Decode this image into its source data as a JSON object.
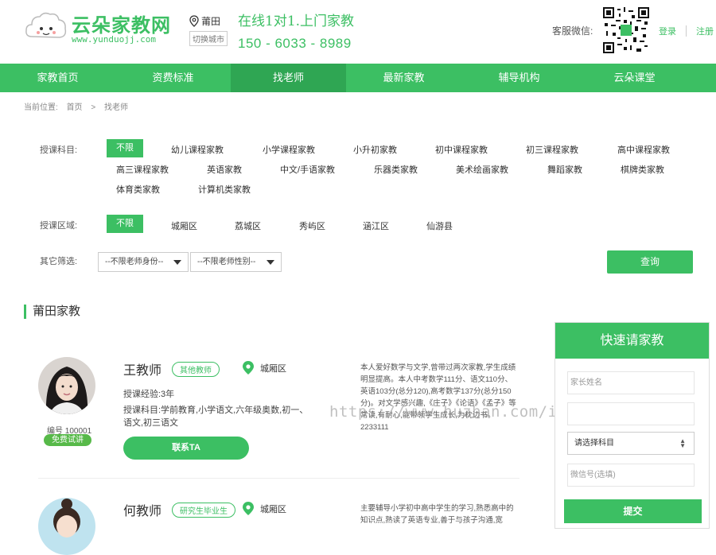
{
  "header": {
    "logo_name": "云朵家教网",
    "logo_url": "www.yunduojj.com",
    "city": "莆田",
    "city_switch": "切换城市",
    "slogan_1": "在线1对1.上门家教",
    "phone": "150 - 6033 - 8989",
    "wechat_label": "客服微信:",
    "login": "登录",
    "register": "注册"
  },
  "nav": [
    "家教首页",
    "资费标准",
    "找老师",
    "最新家教",
    "辅导机构",
    "云朵课堂"
  ],
  "breadcrumb": {
    "prefix": "当前位置:",
    "home": "首页",
    "sep": ">",
    "current": "找老师"
  },
  "filters": {
    "subject_label": "授课科目:",
    "subjects": [
      "不限",
      "幼儿课程家教",
      "小学课程家教",
      "小升初家教",
      "初中课程家教",
      "初三课程家教",
      "高中课程家教",
      "高三课程家教",
      "英语家教",
      "中文/手语家教",
      "乐器类家教",
      "美术绘画家教",
      "舞蹈家教",
      "棋牌类家教",
      "体育类家教",
      "计算机类家教"
    ],
    "area_label": "授课区域:",
    "areas": [
      "不限",
      "城厢区",
      "荔城区",
      "秀屿区",
      "涵江区",
      "仙游县"
    ],
    "other_label": "其它筛选:",
    "identity_select": "--不限老师身份--",
    "gender_select": "--不限老师性别--",
    "query_button": "查询"
  },
  "section_title": "莆田家教",
  "teachers": [
    {
      "name": "王教师",
      "tag": "其他教师",
      "area": "城厢区",
      "experience": "授课经验:3年",
      "subjects": "授课科目:学前教育,小学语文,六年级奥数,初一、语文,初三语文",
      "number": "编号 100001",
      "trial": "免费试讲",
      "contact": "联系TA",
      "desc": "本人爱好数学与文学,曾带过两次家教,学生成绩明显提高。本人中考数学111分、语文110分、英语103分(总分120),高考数学137分(总分150分)。对文学感兴趣,《庄子》《论语》《孟子》等常读,有耐心,能带领学生成长,为枕边书。2233111"
    },
    {
      "name": "何教师",
      "tag": "研究生毕业生",
      "area": "城厢区",
      "desc": "主要辅导小学初中高中学生的学习,熟悉高中的知识点,熟读了英语专业,善于与孩子沟通,宽"
    }
  ],
  "watermark": "https://www.huzhan.com/ishop13808",
  "quick_form": {
    "title": "快速请家教",
    "parent_name_placeholder": "家长姓名",
    "subject_select": "请选择科目",
    "wechat_placeholder": "微信号(选填)",
    "submit": "提交"
  },
  "colors": {
    "brand": "#3cbf63",
    "nav_active": "#2fa653",
    "trial": "#57b949"
  }
}
